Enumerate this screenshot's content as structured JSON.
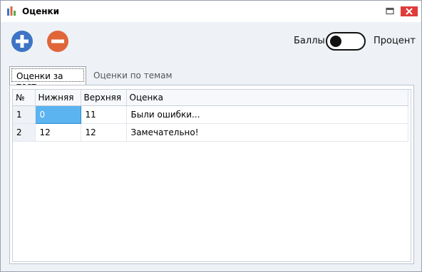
{
  "window": {
    "title": "Оценки"
  },
  "toolbar": {
    "add_icon": "plus-circle-icon",
    "remove_icon": "minus-circle-icon",
    "add_color": "#3d74c4",
    "remove_color": "#e0663a"
  },
  "mode_toggle": {
    "left_label": "Баллы",
    "right_label": "Процент",
    "state": "off"
  },
  "tabs": [
    {
      "label": "Оценки за тест",
      "active": true
    },
    {
      "label": "Оценки по темам",
      "active": false
    }
  ],
  "grid": {
    "columns": [
      "№",
      "Нижняя",
      "Верхняя",
      "Оценка"
    ],
    "rows": [
      {
        "num": "1",
        "lower": "0",
        "upper": "11",
        "grade": "Были ошибки..."
      },
      {
        "num": "2",
        "lower": "12",
        "upper": "12",
        "grade": "Замечательно!"
      }
    ],
    "selected_color": "#5bb3f0"
  }
}
